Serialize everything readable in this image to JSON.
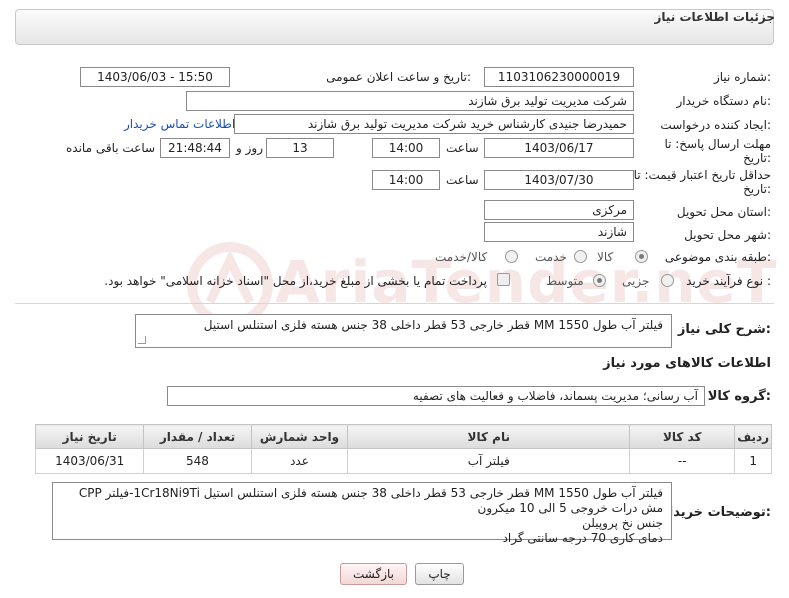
{
  "panel": {
    "title": "جزئیات اطلاعات نیاز"
  },
  "labels": {
    "need_number": "شماره نیاز:",
    "announce_date": "تاریخ و ساعت اعلان عمومی:",
    "buyer_org": "نام دستگاه خریدار:",
    "requester": "ایجاد کننده درخواست:",
    "deadline": "مهلت ارسال پاسخ: تا تاریخ:",
    "hour": "ساعت",
    "day_and": "روز و",
    "remaining": "ساعت باقی مانده",
    "min_validity": "حداقل تاریخ اعتبار قیمت: تا تاریخ:",
    "province": "استان محل تحویل:",
    "city": "شهر محل تحویل:",
    "category": "طبقه بندی موضوعی:",
    "process": "نوع فرآیند خرید :",
    "general_desc": "شرح کلی نیاز:",
    "goods_info": "اطلاعات کالاهای مورد نیاز",
    "goods_group": "گروه کالا:",
    "buyer_notes": "توضیحات خریدار:"
  },
  "values": {
    "need_number": "1103106230000019",
    "announce_date": "1403/06/03 - 15:50",
    "buyer_org": "شرکت مدیریت تولید برق شازند",
    "requester": "حمیدرضا جنیدی کارشناس خرید شرکت مدیریت تولید برق شازند",
    "contact_link": "اطلاعات تماس خریدار",
    "deadline_date": "1403/06/17",
    "deadline_time": "14:00",
    "days": "13",
    "remaining_time": "21:48:44",
    "validity_date": "1403/07/30",
    "validity_time": "14:00",
    "province": "مرکزی",
    "city": "شازند",
    "general_desc": "فیلتر آب طول MM 1550 قطر خارجی 53 قطر داخلی 38 جنس هسته فلزی استنلس استیل",
    "goods_group": "آب رسانی؛ مدیریت پسماند، فاضلاب و فعالیت های تصفیه"
  },
  "category_options": [
    {
      "label": "کالا",
      "selected": true
    },
    {
      "label": "خدمت",
      "selected": false
    },
    {
      "label": "کالا/خدمت",
      "selected": false
    }
  ],
  "process_options": [
    {
      "label": "جزیی",
      "selected": false
    },
    {
      "label": "متوسط",
      "selected": true
    }
  ],
  "payment_note": "پرداخت تمام یا بخشی از مبلغ خرید،از محل \"اسناد خزانه اسلامی\" خواهد بود.",
  "table": {
    "headers": [
      "ردیف",
      "کد کالا",
      "نام کالا",
      "واحد شمارش",
      "تعداد / مقدار",
      "تاریخ نیاز"
    ],
    "rows": [
      [
        "1",
        "--",
        "فیلتر آب",
        "عدد",
        "548",
        "1403/06/31"
      ]
    ]
  },
  "buyer_notes": [
    "فیلتر آب طول MM 1550 قطر خارجی 53 قطر داخلی 38 جنس هسته فلزی استنلس استیل  1Cr18Ni9Ti-فیلتر CPP",
    "مش درات  خروجی 5 الی 10 میکرون",
    "جنس نخ پروپیلن",
    "دمای کاری 70 درجه سانتی گراد"
  ],
  "buttons": {
    "print": "چاپ",
    "back": "بازگشت"
  },
  "watermark": "AriaTender.neT",
  "colors": {
    "link": "#1a4fb8",
    "watermark": "#c43a3a"
  }
}
